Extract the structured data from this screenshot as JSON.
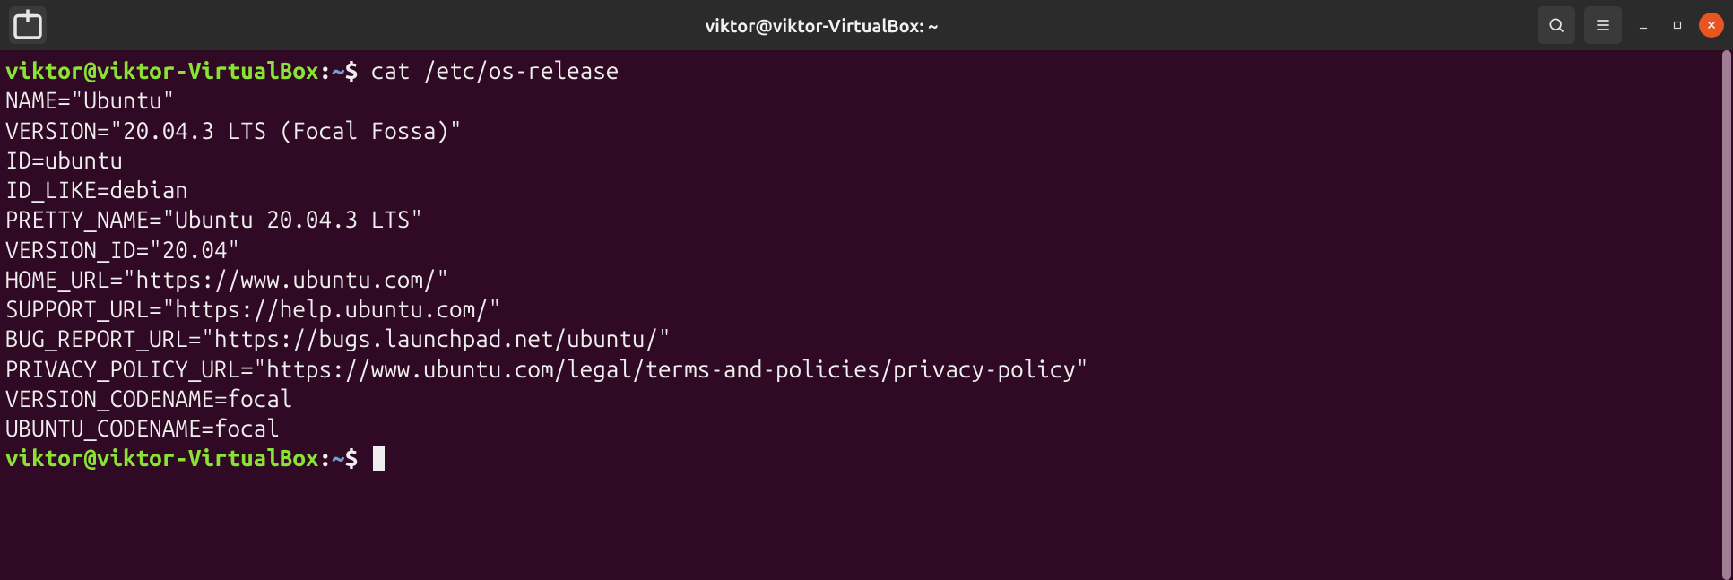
{
  "window": {
    "title": "viktor@viktor-VirtualBox: ~"
  },
  "prompt": {
    "userhost": "viktor@viktor-VirtualBox",
    "colon": ":",
    "path": "~",
    "symbol": "$"
  },
  "session": {
    "command1": "cat /etc/os-release",
    "output": [
      "NAME=\"Ubuntu\"",
      "VERSION=\"20.04.3 LTS (Focal Fossa)\"",
      "ID=ubuntu",
      "ID_LIKE=debian",
      "PRETTY_NAME=\"Ubuntu 20.04.3 LTS\"",
      "VERSION_ID=\"20.04\"",
      "HOME_URL=\"https://www.ubuntu.com/\"",
      "SUPPORT_URL=\"https://help.ubuntu.com/\"",
      "BUG_REPORT_URL=\"https://bugs.launchpad.net/ubuntu/\"",
      "PRIVACY_POLICY_URL=\"https://www.ubuntu.com/legal/terms-and-policies/privacy-policy\"",
      "VERSION_CODENAME=focal",
      "UBUNTU_CODENAME=focal"
    ]
  }
}
